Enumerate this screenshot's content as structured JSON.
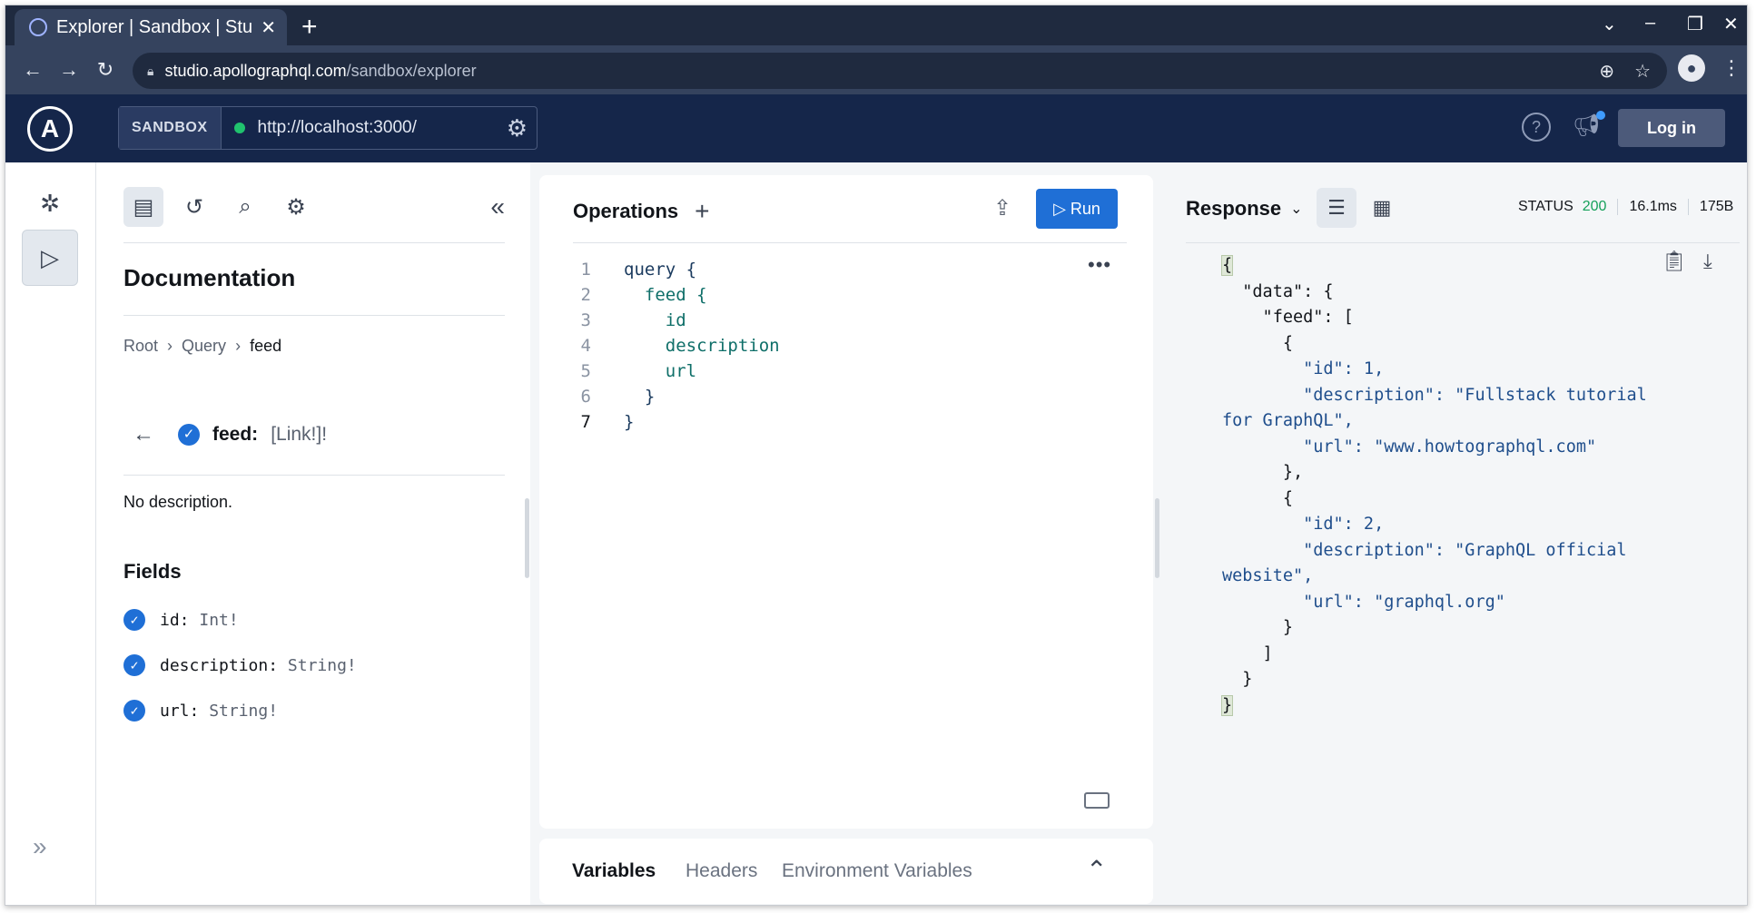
{
  "browser": {
    "tab_title": "Explorer | Sandbox | Stu",
    "tab_close": "✕",
    "new_tab": "+",
    "window_controls": [
      "⌄",
      "–",
      "❐",
      "✕"
    ],
    "url_host": "studio.apollographql.com",
    "url_path": "/sandbox/explorer"
  },
  "header": {
    "logo": "A",
    "sandbox_label": "SANDBOX",
    "endpoint": "http://localhost:3000/",
    "help": "?",
    "login_label": "Log in"
  },
  "docs": {
    "title": "Documentation",
    "breadcrumb": [
      "Root",
      "Query",
      "feed"
    ],
    "field_name": "feed:",
    "field_type": "[Link!]!",
    "description": "No description.",
    "fields_title": "Fields",
    "fields": [
      {
        "name": "id:",
        "type": "Int!"
      },
      {
        "name": "description:",
        "type": "String!"
      },
      {
        "name": "url:",
        "type": "String!"
      }
    ]
  },
  "operations": {
    "title": "Operations",
    "run_label": "▷ Run",
    "lines": [
      {
        "num": "1",
        "text": "query {"
      },
      {
        "num": "2",
        "text": "  feed {"
      },
      {
        "num": "3",
        "text": "    id"
      },
      {
        "num": "4",
        "text": "    description"
      },
      {
        "num": "5",
        "text": "    url"
      },
      {
        "num": "6",
        "text": "  }"
      },
      {
        "num": "7",
        "text": "}"
      }
    ]
  },
  "variables_tabs": [
    "Variables",
    "Headers",
    "Environment Variables"
  ],
  "response": {
    "title": "Response",
    "status_label": "STATUS",
    "status_code": "200",
    "time": "16.1ms",
    "size": "175B",
    "json_lines": [
      "{",
      "  \"data\": {",
      "    \"feed\": [",
      "      {",
      "        \"id\": 1,",
      "        \"description\": \"Fullstack tutorial",
      "for GraphQL\",",
      "        \"url\": \"www.howtographql.com\"",
      "      },",
      "      {",
      "        \"id\": 2,",
      "        \"description\": \"GraphQL official",
      "website\",",
      "        \"url\": \"graphql.org\"",
      "      }",
      "    ]",
      "  }",
      "}"
    ]
  },
  "colors": {
    "accent": "#1f6fd6",
    "header_bg": "#15264a",
    "status_ok": "#16a05a"
  }
}
